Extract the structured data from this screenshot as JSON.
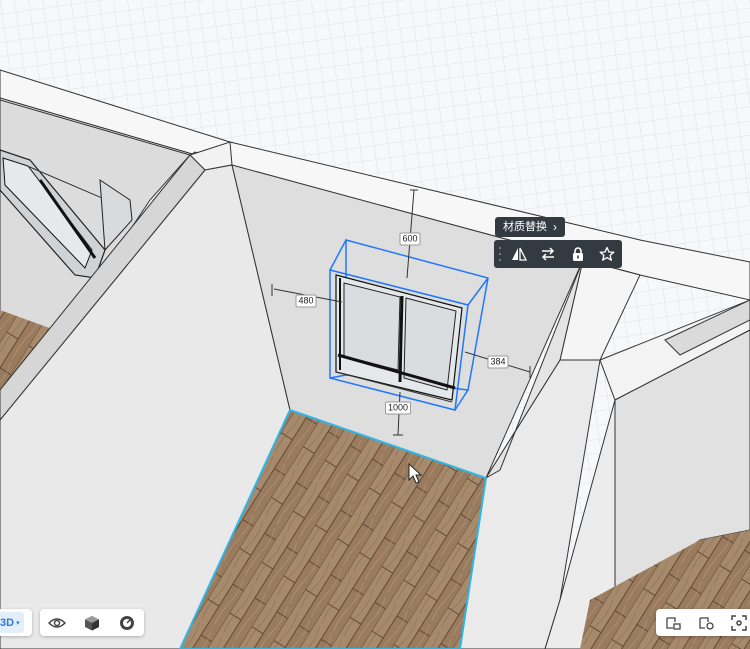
{
  "viewport": {
    "dimensions": {
      "top": "600",
      "left": "480",
      "right": "384",
      "bottom": "1000"
    }
  },
  "toolbar": {
    "material_replace_label": "材质替换",
    "material_replace_chevron": "›",
    "buttons": [
      "mirror-icon",
      "swap-icon",
      "lock-icon",
      "star-icon"
    ]
  },
  "view_mode": {
    "current": "3D",
    "caret": "▾"
  },
  "bottom_left_tools": [
    "eye-icon",
    "cube-icon",
    "camera-icon"
  ],
  "bottom_right_tools": [
    "room-view-icon",
    "room-settings-icon",
    "fullscreen-icon"
  ],
  "colors": {
    "accent": "#2d7ad6",
    "selection_blue": "#1f78ff",
    "floor_outline": "#2fb6e6",
    "toolbar_bg": "#333a42"
  }
}
